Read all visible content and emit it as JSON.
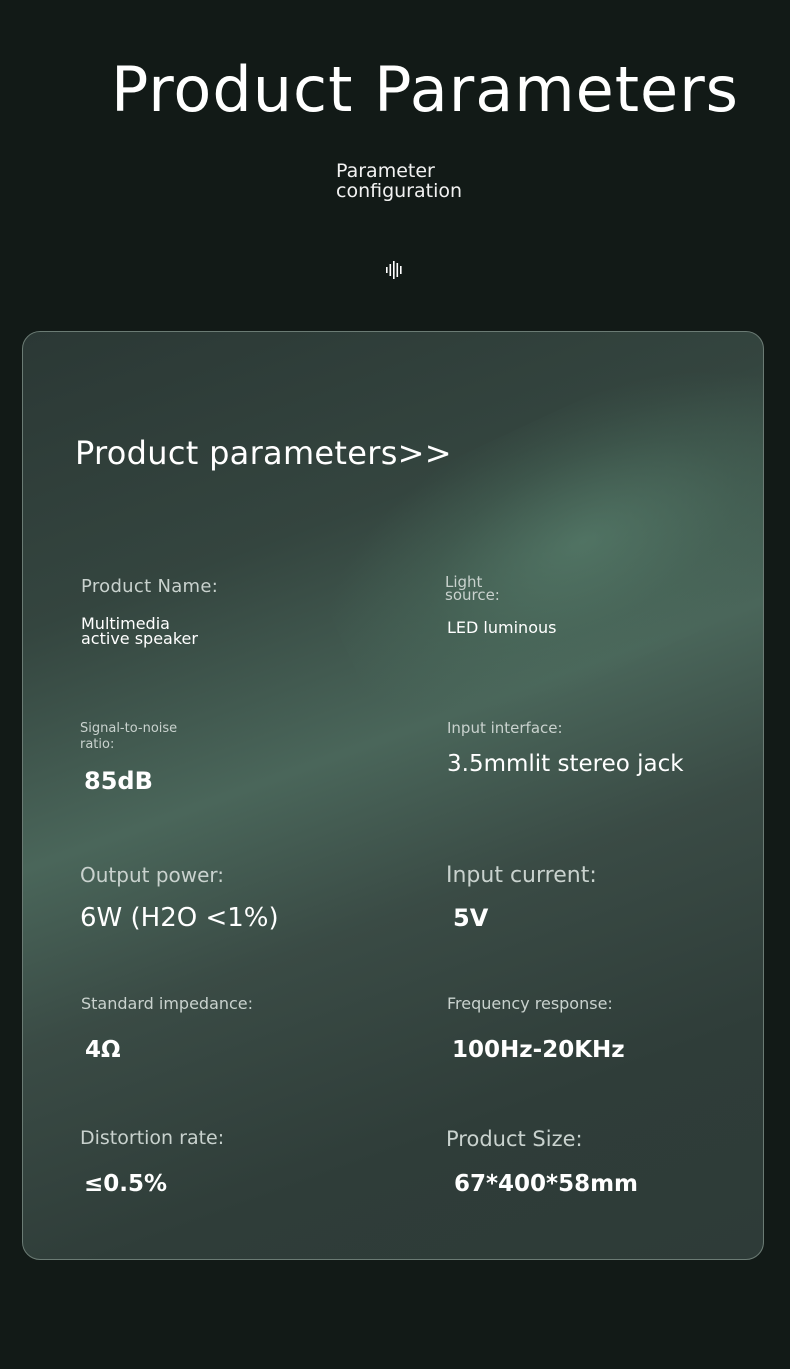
{
  "hero": {
    "title": "Product Parameters",
    "subtitle": "Parameter configuration"
  },
  "card": {
    "title": "Product parameters>>"
  },
  "params": {
    "product_name": {
      "label": "Product Name:",
      "value": "Multimedia active speaker"
    },
    "light_source": {
      "label": "Light source:",
      "value": "LED luminous"
    },
    "snr": {
      "label": "Signal-to-noise ratio:",
      "value": "85dB"
    },
    "input_interface": {
      "label": "Input interface:",
      "value": "3.5mmlit stereo jack"
    },
    "output_power": {
      "label": "Output power:",
      "value": "6W (H2O <1%)"
    },
    "input_current": {
      "label": "Input current:",
      "value": "5V"
    },
    "impedance": {
      "label": "Standard impedance:",
      "value": "4Ω"
    },
    "frequency": {
      "label": "Frequency response:",
      "value": "100Hz-20KHz"
    },
    "distortion": {
      "label": "Distortion rate:",
      "value": "≤0.5%"
    },
    "size": {
      "label": "Product Size:",
      "value": "67*400*58mm"
    }
  },
  "icons": {
    "wave": "sound-wave-icon"
  },
  "colors": {
    "background": "#121a17",
    "card": "#34453f",
    "accent": "#4a665a"
  }
}
